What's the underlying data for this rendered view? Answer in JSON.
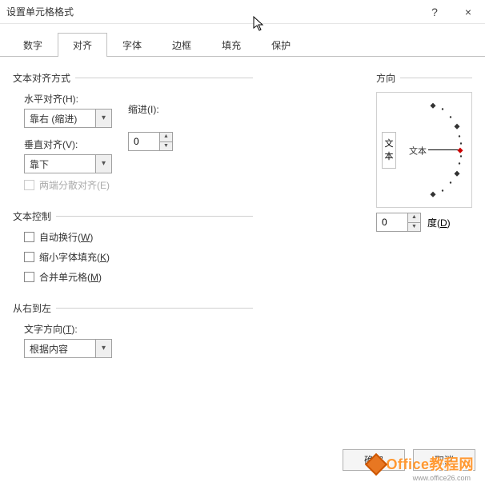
{
  "window": {
    "title": "设置单元格格式",
    "help": "?",
    "close": "×"
  },
  "tabs": {
    "number": "数字",
    "alignment": "对齐",
    "font": "字体",
    "border": "边框",
    "fill": "填充",
    "protection": "保护"
  },
  "groups": {
    "text_alignment": "文本对齐方式",
    "text_control": "文本控制",
    "rtl": "从右到左",
    "orientation": "方向"
  },
  "labels": {
    "horizontal": "水平对齐(H):",
    "vertical": "垂直对齐(V):",
    "indent": "缩进(I):",
    "text_direction": "文字方向(T):",
    "degrees": "度(D)"
  },
  "values": {
    "horizontal": "靠右 (缩进)",
    "vertical": "靠下",
    "indent": "0",
    "text_direction": "根据内容",
    "orientation_deg": "0"
  },
  "checkboxes": {
    "justify_distributed": "两端分散对齐(E)",
    "wrap_text": "自动换行(W)",
    "shrink_to_fit": "缩小字体填充(K)",
    "merge_cells": "合并单元格(M)"
  },
  "orientation": {
    "vertical_text": "文本",
    "horizontal_text": "文本"
  },
  "buttons": {
    "ok": "确定",
    "cancel": "取消"
  },
  "watermark": {
    "main": "Office教程网",
    "sub": "www.office26.com"
  }
}
